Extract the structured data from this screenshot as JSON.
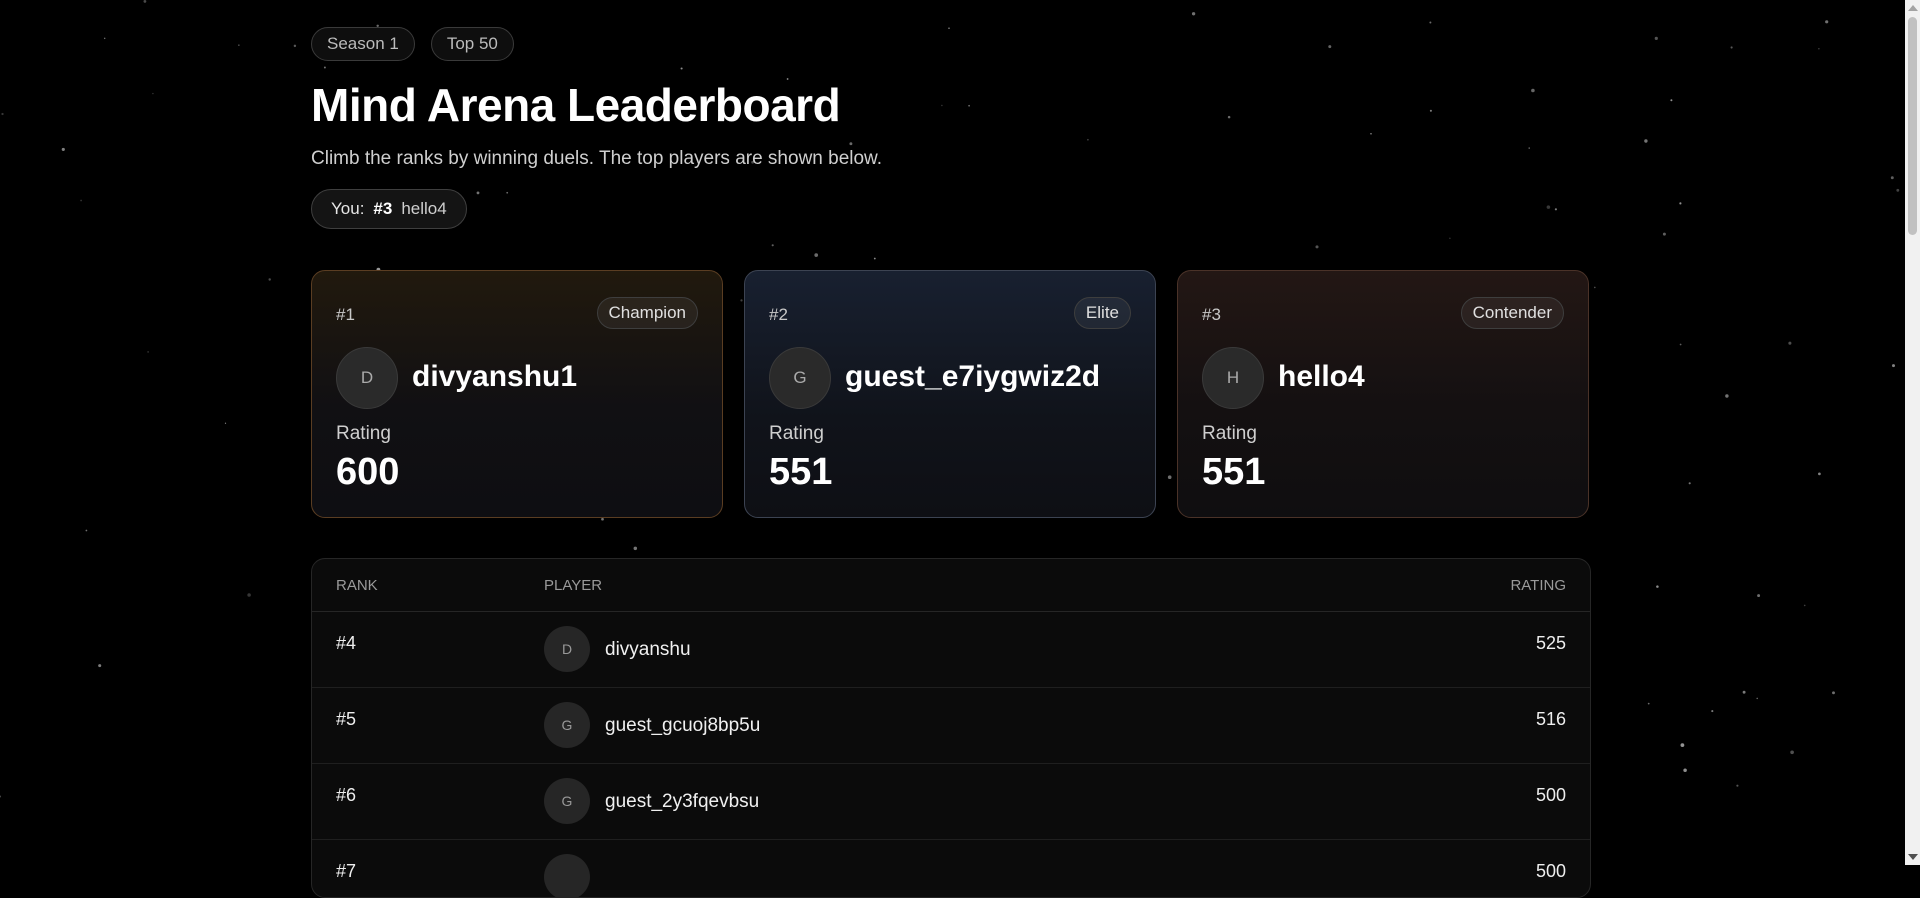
{
  "chips": [
    "Season 1",
    "Top 50"
  ],
  "title": "Mind Arena Leaderboard",
  "subtitle": "Climb the ranks by winning duels. The top players are shown below.",
  "you": {
    "label": "You:",
    "rank": "#3",
    "name": "hello4"
  },
  "podium": [
    {
      "rank": "#1",
      "tier": "Champion",
      "initial": "D",
      "name": "divyanshu1",
      "rating_label": "Rating",
      "rating": "600"
    },
    {
      "rank": "#2",
      "tier": "Elite",
      "initial": "G",
      "name": "guest_e7iygwiz2d",
      "rating_label": "Rating",
      "rating": "551"
    },
    {
      "rank": "#3",
      "tier": "Contender",
      "initial": "H",
      "name": "hello4",
      "rating_label": "Rating",
      "rating": "551"
    }
  ],
  "table": {
    "headers": {
      "rank": "RANK",
      "player": "PLAYER",
      "rating": "RATING"
    },
    "rows": [
      {
        "rank": "#4",
        "initial": "D",
        "name": "divyanshu",
        "rating": "525"
      },
      {
        "rank": "#5",
        "initial": "G",
        "name": "guest_gcuoj8bp5u",
        "rating": "516"
      },
      {
        "rank": "#6",
        "initial": "G",
        "name": "guest_2y3fqevbsu",
        "rating": "500"
      },
      {
        "rank": "#7",
        "initial": "",
        "name": "",
        "rating": "500"
      }
    ]
  }
}
